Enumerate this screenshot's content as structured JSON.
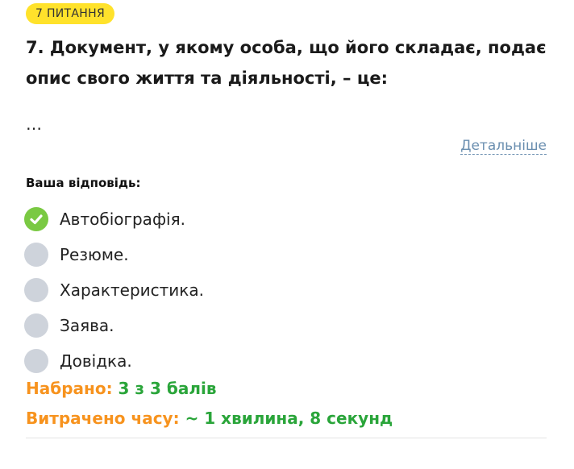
{
  "badge": {
    "label": "7 ПИТАННЯ",
    "color": "#ffe22b"
  },
  "question": {
    "text": "7. Документ, у якому особа, що його складає, подає опис свого життя та діяльності, – це:",
    "ellipsis": "…"
  },
  "details_link": {
    "label": "Детальніше",
    "color": "#6b8fb0"
  },
  "answer": {
    "label": "Ваша відповідь:",
    "options": [
      {
        "text": "Автобіографія.",
        "selected": true,
        "icon": "check-icon"
      },
      {
        "text": "Резюме.",
        "selected": false
      },
      {
        "text": "Характеристика.",
        "selected": false
      },
      {
        "text": "Заява.",
        "selected": false
      },
      {
        "text": "Довідка.",
        "selected": false
      }
    ]
  },
  "result": {
    "score_label": "Набрано:",
    "score_value": "3 з 3 балів",
    "time_label": "Витрачено часу:",
    "time_value": "~ 1 хвилина, 8 секунд",
    "label_color": "#f7931e",
    "value_color": "#2aa53a"
  }
}
